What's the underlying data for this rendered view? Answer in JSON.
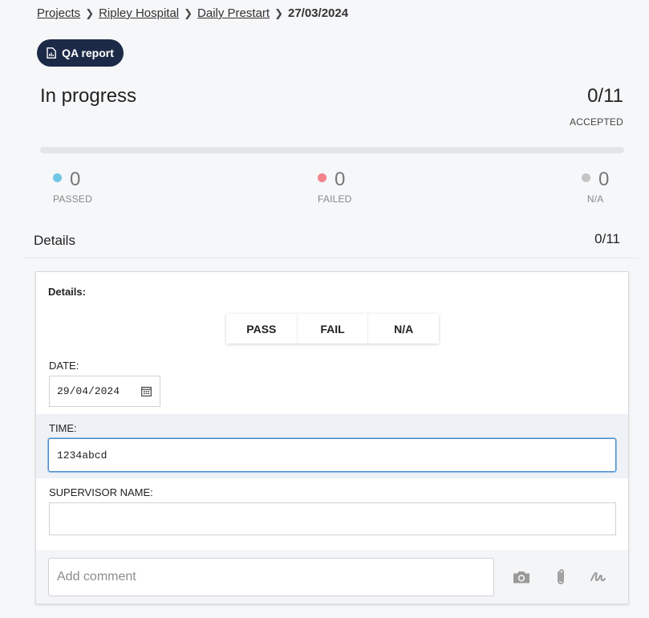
{
  "breadcrumb": {
    "items": [
      "Projects",
      "Ripley Hospital",
      "Daily Prestart"
    ],
    "current": "27/03/2024"
  },
  "qa_report": {
    "label": "QA report",
    "icon": "report-icon"
  },
  "summary": {
    "status": "In progress",
    "accepted_count": "0/11",
    "accepted_label": "ACCEPTED",
    "progress": 0,
    "passed": {
      "value": "0",
      "label": "PASSED",
      "color": "#70c7e4"
    },
    "failed": {
      "value": "0",
      "label": "FAILED",
      "color": "#f3838a"
    },
    "na": {
      "value": "0",
      "label": "N/A",
      "color": "#c4c4c4"
    }
  },
  "details_section": {
    "title": "Details",
    "count": "0/11"
  },
  "card": {
    "title": "Details:",
    "result_buttons": [
      "PASS",
      "FAIL",
      "N/A"
    ],
    "date": {
      "label": "DATE:",
      "value": "29/04/2024"
    },
    "time": {
      "label": "TIME:",
      "value": "1234abcd"
    },
    "supervisor": {
      "label": "SUPERVISOR NAME:",
      "value": ""
    },
    "comment": {
      "placeholder": "Add comment"
    }
  }
}
